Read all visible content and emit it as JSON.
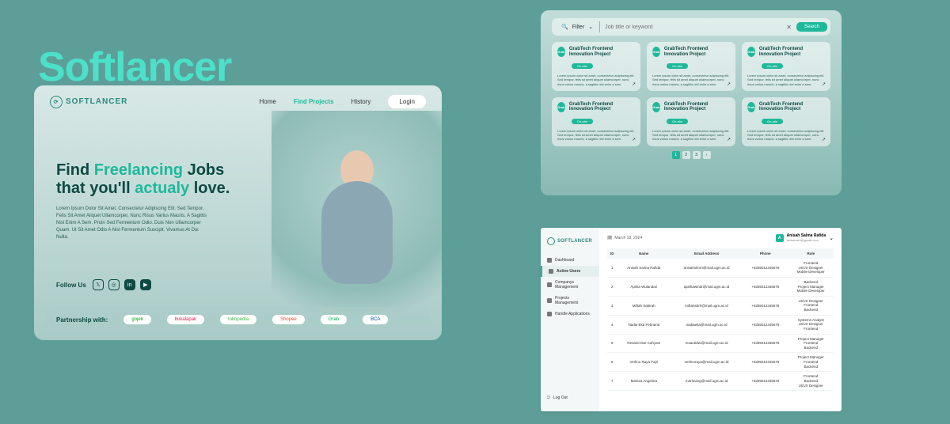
{
  "brand_title": "Softlancer",
  "panel1": {
    "logo_text": "SOFTLANCER",
    "nav": {
      "home": "Home",
      "find": "Find Projects",
      "history": "History"
    },
    "login": "Login",
    "headline_pre": "Find ",
    "headline_teal1": "Freelancing",
    "headline_mid": " Jobs\nthat you'll ",
    "headline_teal2": "actualy",
    "headline_post": " love.",
    "desc": "Lorem Ipsum Dolor Sit Amet, Consectetur Adipiscing Elit. Sed Tempor, Felis Sit Amet Aliquet Ullamcorper, Nunc Risus Varius Mauris, A Sagittis Nisl Enim A Sem. Proin Sed Fermentum Odio. Duis Non Ullamcorper Quam. Ut Sit Amet Odio A Nisl Fermentum Suscipit. Vivamus At Dui Nulla.",
    "follow": "Follow Us",
    "partner_label": "Partnership with:",
    "partners": [
      "gojek",
      "bukalapak",
      "tokopedia",
      "Shopee",
      "Grab",
      "BCA"
    ]
  },
  "panel2": {
    "filter": "Filter",
    "placeholder": "Job title or keyword",
    "search": "Search",
    "card_title": "GrabTech Frontend Innovation Project",
    "badge": "On-site",
    "card_desc": "Lorem ipsum dolor sit amet, consectetur adipiscing elit. Sed tempor, felis sit amet aliquet ullamcorper, nunc risus varius mauris, a sagittis nisl enim a sem.",
    "pages": [
      "1",
      "2",
      "3"
    ]
  },
  "panel3": {
    "logo_text": "SOFTLANCER",
    "sidebar": [
      "Dashboard",
      "Active Users",
      "Companys Management",
      "Projects Management",
      "Handle Applications"
    ],
    "logout": "Log Out",
    "date": "March 18, 2024",
    "user_name": "Anisah Salma Rafida",
    "user_email": "anisahslm@gmail.com",
    "headers": {
      "id": "ID",
      "name": "Name",
      "email": "Email Address",
      "phone": "Phone",
      "role": "Role"
    },
    "rows": [
      {
        "id": "1",
        "name": "Anisah Salma Rafida",
        "email": "anisahslmrn@mail.ugm.ac.id",
        "phone": "+6285012345678",
        "role": "Frontend\nUI/UX Designer\nMobile Developer"
      },
      {
        "id": "2",
        "name": "Aprilia Wulandari",
        "email": "aprilliawlndr@mail.ugm.ac.id",
        "phone": "+6285012345678",
        "role": "Backend\nProject Manager\nMobile Developer"
      },
      {
        "id": "3",
        "name": "Miftah Sabirah",
        "email": "miftahsbrh@mail.ugm.ac.id",
        "phone": "+6285012345678",
        "role": "UI/UX Designer\nFrontend\nBackend"
      },
      {
        "id": "4",
        "name": "Nadia Eka Febrianti",
        "email": "nadiaeka@mail.ugm.ac.id",
        "phone": "+6285012345678",
        "role": "Systems Analyst\nUI/UX Designer\nFrontend"
      },
      {
        "id": "5",
        "name": "Resanti Dwi Cahyani",
        "email": "resantidwi@mail.ugm.ac.id",
        "phone": "+6285012345678",
        "role": "Project Manager\nFrontend\nBackend"
      },
      {
        "id": "6",
        "name": "Verlino Raya Fajri",
        "email": "verlinoraya@mail.ugm.ac.id",
        "phone": "+6285012345678",
        "role": "Project Manager\nFrontend\nBackend"
      },
      {
        "id": "7",
        "name": "Maritza Angelina",
        "email": "maritzang@mail.ugm.ac.id",
        "phone": "+6285012345678",
        "role": "Frontend\nBackend\nUI/UX Designer"
      }
    ]
  }
}
